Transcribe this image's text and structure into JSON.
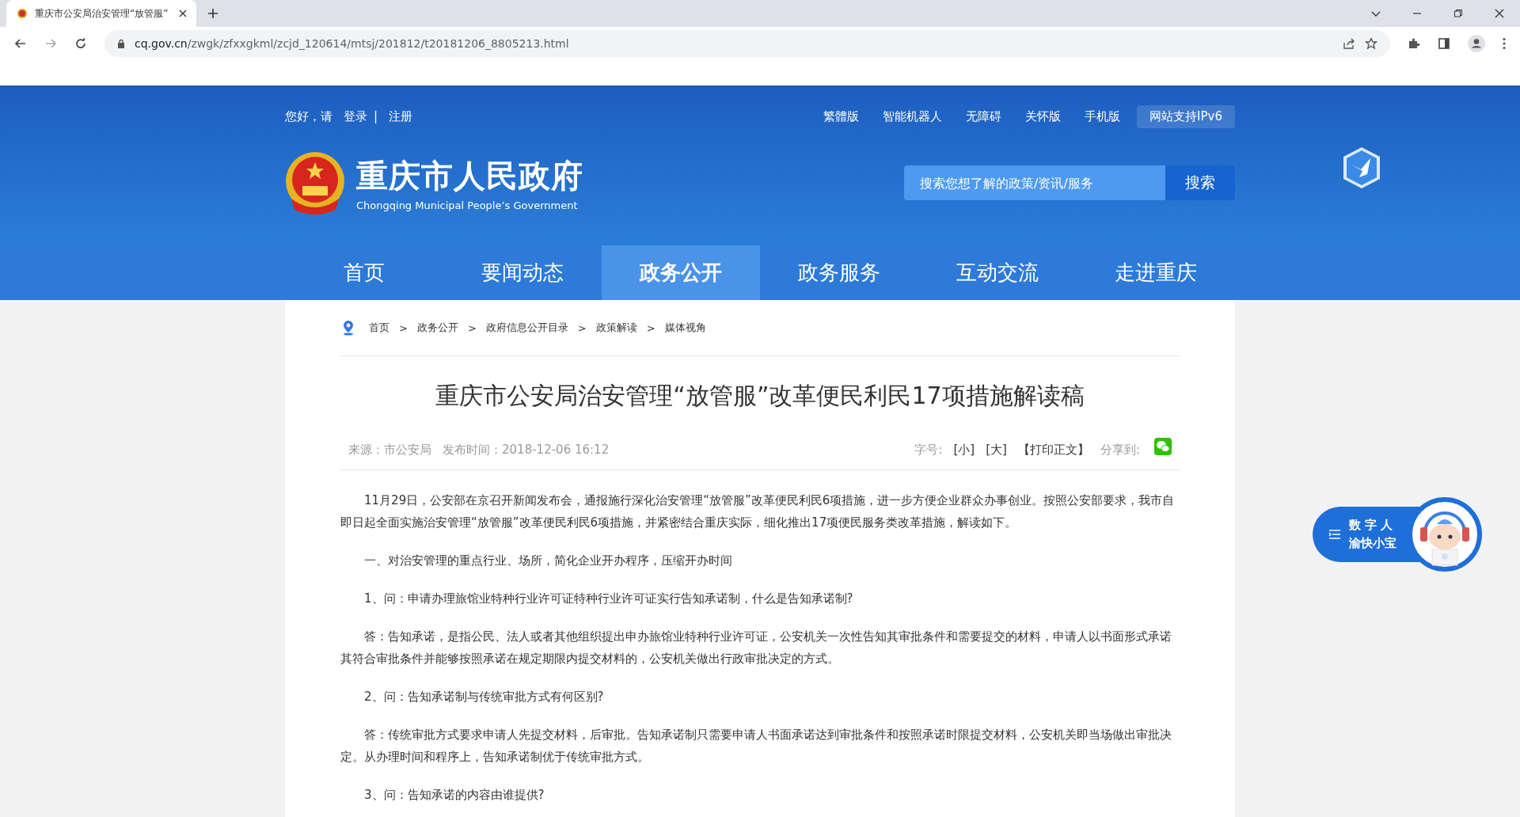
{
  "browser": {
    "tab_title": "重庆市公安局治安管理“放管服”",
    "url_host": "cq.gov.cn",
    "url_path": "/zwgk/zfxxgkml/zcjd_120614/mtsj/201812/t20181206_8805213.html"
  },
  "header": {
    "greeting": "您好，请",
    "login": "登录",
    "divider": "|",
    "register": "注册",
    "top_links": [
      {
        "label": "繁體版",
        "boxed": false
      },
      {
        "label": "智能机器人",
        "boxed": false
      },
      {
        "label": "无障碍",
        "boxed": false
      },
      {
        "label": "关怀版",
        "boxed": false
      },
      {
        "label": "手机版",
        "boxed": false
      },
      {
        "label": "网站支持IPv6",
        "boxed": true
      }
    ],
    "site_name": "重庆市人民政府",
    "site_name_en": "Chongqing Municipal People’s Government",
    "search": {
      "placeholder": "搜索您想了解的政策/资讯/服务",
      "button": "搜索"
    }
  },
  "nav": [
    {
      "label": "首页",
      "selected": false
    },
    {
      "label": "要闻动态",
      "selected": false
    },
    {
      "label": "政务公开",
      "selected": true
    },
    {
      "label": "政务服务",
      "selected": false
    },
    {
      "label": "互动交流",
      "selected": false
    },
    {
      "label": "走进重庆",
      "selected": false
    }
  ],
  "breadcrumb": [
    {
      "label": "首页",
      "separator": ">"
    },
    {
      "label": "政务公开",
      "separator": ">"
    },
    {
      "label": "政府信息公开目录",
      "separator": ">"
    },
    {
      "label": "政策解读",
      "separator": ">"
    },
    {
      "label": "媒体视角"
    }
  ],
  "article": {
    "title": "重庆市公安局治安管理“放管服”改革便民利民17项措施解读稿",
    "source": "来源：市公安局",
    "published": "发布时间：2018-12-06 16:12",
    "font_size_label": "字号:",
    "font_small": "[小]",
    "font_large": "[大]",
    "print": "【打印正文】",
    "share_label": "分享到:",
    "paragraphs": [
      "11月29日，公安部在京召开新闻发布会，通报施行深化治安管理“放管服”改革便民利民6项措施，进一步方便企业群众办事创业。按照公安部要求，我市自即日起全面实施治安管理“放管服”改革便民利民6项措施，并紧密结合重庆实际，细化推出17项便民服务类改革措施，解读如下。",
      "一、对治安管理的重点行业、场所，简化企业开办程序，压缩开办时间",
      "1、问：申请办理旅馆业特种行业许可证特种行业许可证实行告知承诺制，什么是告知承诺制?",
      "答：告知承诺，是指公民、法人或者其他组织提出申办旅馆业特种行业许可证，公安机关一次性告知其审批条件和需要提交的材料，申请人以书面形式承诺其符合审批条件并能够按照承诺在规定期限内提交材料的，公安机关做出行政审批决定的方式。",
      "2、问：告知承诺制与传统审批方式有何区别?",
      "答：传统审批方式要求申请人先提交材料，后审批。告知承诺制只需要申请人书面承诺达到审批条件和按照承诺时限提交材料，公安机关即当场做出审批决定。从办理时间和程序上，告知承诺制优于传统审批方式。",
      "3、问：告知承诺的内容由谁提供?"
    ]
  },
  "assistant": {
    "line1": "数 字 人",
    "line2": "渝快小宝"
  }
}
